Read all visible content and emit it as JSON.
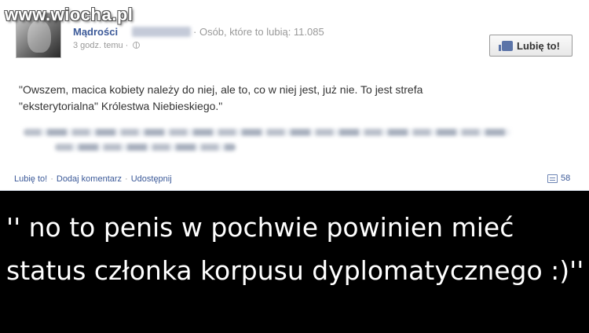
{
  "watermark": "www.wiocha.pl",
  "post": {
    "page_name": "Mądrości",
    "separator": "·",
    "likes_text": "Osób, które to lubią: 11.085",
    "time": "3 godz. temu",
    "like_page_label": "Lubię to!",
    "quote": "\"Owszem, macica kobiety należy do niej, ale to, co w niej jest, już nie. To jest strefa\n\"eksterytorialna\" Królestwa Niebieskiego.\""
  },
  "actions": {
    "like": "Lubię to!",
    "comment": "Dodaj komentarz",
    "share": "Udostępnij",
    "comment_count": "58"
  },
  "caption": "'' no to penis w pochwie powinien mieć\nstatus członka korpusu dyplomatycznego :)''"
}
